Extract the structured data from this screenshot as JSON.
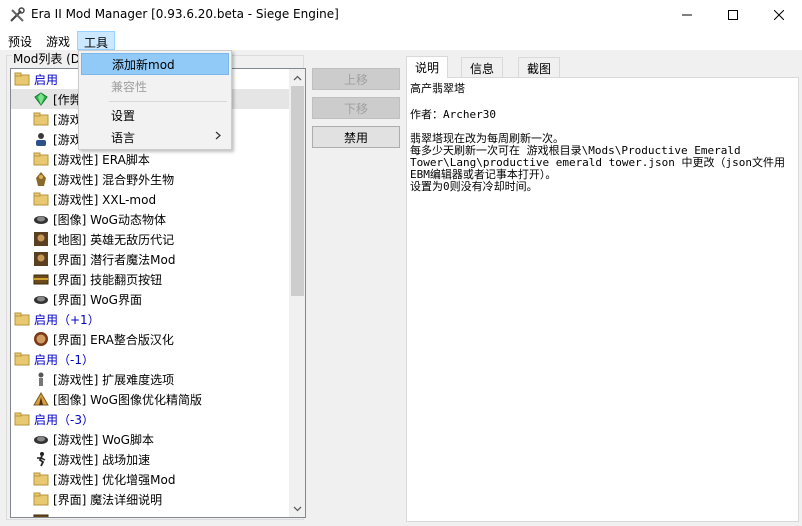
{
  "window": {
    "title": "Era II Mod Manager [0.93.6.20.beta - Siege Engine]"
  },
  "menubar": {
    "items": [
      {
        "label": "预设"
      },
      {
        "label": "游戏"
      },
      {
        "label": "工具"
      }
    ]
  },
  "tools_menu": {
    "items": [
      {
        "label": "添加新mod",
        "state": "hover"
      },
      {
        "label": "兼容性",
        "state": "disabled"
      },
      {
        "label": "设置",
        "state": "normal"
      },
      {
        "label": "语言",
        "state": "submenu"
      }
    ]
  },
  "mod_list": {
    "caption": "Mod列表 (D:",
    "rows": [
      {
        "kind": "group",
        "label": "启用",
        "icon": "folder-icon"
      },
      {
        "kind": "mod",
        "label": "[作弊",
        "icon": "gem-icon",
        "selected": true
      },
      {
        "kind": "mod",
        "label": "[游戏",
        "icon": "folder-icon"
      },
      {
        "kind": "mod",
        "label": "[游戏",
        "icon": "person-icon"
      },
      {
        "kind": "mod",
        "label": "[游戏性] ERA脚本",
        "icon": "folder-icon"
      },
      {
        "kind": "mod",
        "label": "[游戏性] 混合野外生物",
        "icon": "creature-icon"
      },
      {
        "kind": "mod",
        "label": "[游戏性] XXL-mod",
        "icon": "folder-icon"
      },
      {
        "kind": "mod",
        "label": "[图像] WoG动态物体",
        "icon": "wog-icon"
      },
      {
        "kind": "mod",
        "label": "[地图] 英雄无敌历代记",
        "icon": "portrait-icon"
      },
      {
        "kind": "mod",
        "label": "[界面] 潜行者魔法Mod",
        "icon": "portrait-icon"
      },
      {
        "kind": "mod",
        "label": "[界面] 技能翻页按钮",
        "icon": "chest-icon"
      },
      {
        "kind": "mod",
        "label": "[界面] WoG界面",
        "icon": "wog-icon"
      },
      {
        "kind": "group",
        "label": "启用（+1）",
        "icon": "folder-icon"
      },
      {
        "kind": "mod",
        "label": "[界面] ERA整合版汉化",
        "icon": "face-icon"
      },
      {
        "kind": "group",
        "label": "启用（-1）",
        "icon": "folder-icon"
      },
      {
        "kind": "mod",
        "label": "[游戏性] 扩展难度选项",
        "icon": "knight-icon"
      },
      {
        "kind": "mod",
        "label": "[图像] WoG图像优化精简版",
        "icon": "tent-icon"
      },
      {
        "kind": "group",
        "label": "启用（-3）",
        "icon": "folder-icon"
      },
      {
        "kind": "mod",
        "label": "[游戏性] WoG脚本",
        "icon": "wog-icon"
      },
      {
        "kind": "mod",
        "label": "[游戏性] 战场加速",
        "icon": "runner-icon"
      },
      {
        "kind": "mod",
        "label": "[游戏性] 优化增强Mod",
        "icon": "folder-icon"
      },
      {
        "kind": "mod",
        "label": "[界面] 魔法详细说明",
        "icon": "folder-icon"
      },
      {
        "kind": "mod",
        "label": "",
        "icon": "chest-icon"
      }
    ]
  },
  "buttons": {
    "move_up": "上移",
    "move_down": "下移",
    "disable": "禁用"
  },
  "tabs": [
    {
      "label": "说明",
      "active": true
    },
    {
      "label": "信息",
      "active": false
    },
    {
      "label": "截图",
      "active": false
    }
  ],
  "description": {
    "lines": [
      "高产翡翠塔",
      "",
      "作者：Archer30",
      "",
      "翡翠塔现在改为每周刷新一次。",
      "每多少天刷新一次可在 游戏根目录\\Mods\\Productive Emerald",
      "Tower\\Lang\\productive emerald tower.json 中更改（json文件用",
      "EBM编辑器或者记事本打开）。",
      "设置为0则没有冷却时间。"
    ]
  },
  "colors": {
    "group_text": "#0000c8",
    "menu_highlight": "#cce8ff",
    "dropdown_hover": "#91c9f7",
    "folder": "#e8c870"
  }
}
